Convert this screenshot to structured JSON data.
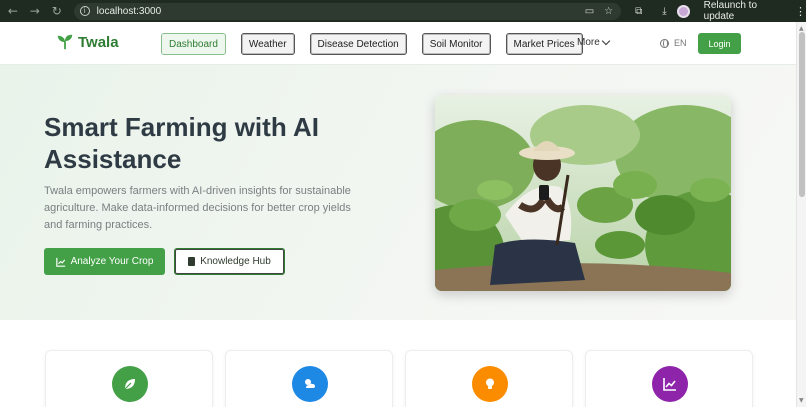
{
  "browser": {
    "url": "localhost:3000",
    "relaunch_label": "Relaunch to update"
  },
  "header": {
    "brand": "Twala",
    "nav": [
      {
        "label": "Dashboard",
        "active": true
      },
      {
        "label": "Weather",
        "active": false
      },
      {
        "label": "Disease Detection",
        "active": false
      },
      {
        "label": "Soil Monitor",
        "active": false
      },
      {
        "label": "Market Prices",
        "active": false
      }
    ],
    "more_label": "More",
    "language": "EN",
    "login_label": "Login"
  },
  "hero": {
    "title": "Smart Farming with AI Assistance",
    "description": "Twala empowers farmers with AI-driven insights for sustainable agriculture. Make data-informed decisions for better crop yields and farming practices.",
    "primary_button": "Analyze Your Crop",
    "secondary_button": "Knowledge Hub"
  },
  "features": [
    {
      "icon": "leaf-icon",
      "color": "#43a047"
    },
    {
      "icon": "weather-icon",
      "color": "#1e88e5"
    },
    {
      "icon": "lightbulb-icon",
      "color": "#fb8c00"
    },
    {
      "icon": "chart-icon",
      "color": "#8e24aa"
    }
  ],
  "colors": {
    "brand_green": "#2e7d32",
    "button_green": "#43a047",
    "title_text": "#2f3b44"
  }
}
